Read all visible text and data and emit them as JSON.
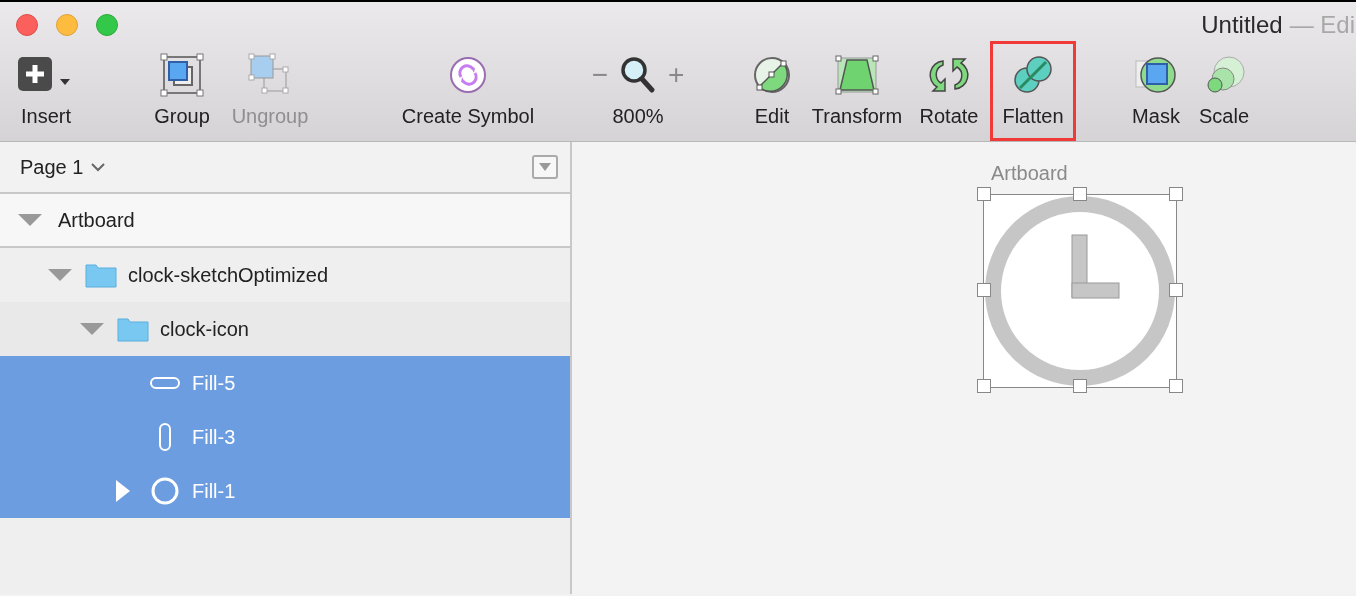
{
  "window": {
    "title": "Untitled",
    "subtitle": "— Edi"
  },
  "toolbar": [
    {
      "kind": "insert",
      "label": "Insert",
      "disabled": false,
      "highlighted": false
    },
    {
      "kind": "group",
      "label": "Group",
      "disabled": false,
      "highlighted": false
    },
    {
      "kind": "ungroup",
      "label": "Ungroup",
      "disabled": true,
      "highlighted": false
    },
    {
      "kind": "symbol",
      "label": "Create Symbol",
      "disabled": false,
      "highlighted": false
    },
    {
      "kind": "zoom",
      "label": "800%",
      "minus": "−",
      "plus": "+",
      "disabled": false,
      "highlighted": false
    },
    {
      "kind": "edit",
      "label": "Edit",
      "disabled": false,
      "highlighted": false
    },
    {
      "kind": "transform",
      "label": "Transform",
      "disabled": false,
      "highlighted": false
    },
    {
      "kind": "rotate",
      "label": "Rotate",
      "disabled": false,
      "highlighted": false
    },
    {
      "kind": "flatten",
      "label": "Flatten",
      "disabled": false,
      "highlighted": true
    },
    {
      "kind": "mask",
      "label": "Mask",
      "disabled": false,
      "highlighted": false
    },
    {
      "kind": "scale",
      "label": "Scale",
      "disabled": false,
      "highlighted": false
    }
  ],
  "page_selector": {
    "label": "Page 1"
  },
  "layers": [
    {
      "kind": "artboard",
      "name": "Artboard",
      "expanded": true,
      "selected": false,
      "children": [
        {
          "kind": "folder",
          "name": "clock-sketchOptimized",
          "expanded": true,
          "selected": false,
          "children": [
            {
              "kind": "folder",
              "name": "clock-icon",
              "expanded": true,
              "selected": false,
              "children": [
                {
                  "kind": "hbar",
                  "name": "Fill-5",
                  "selected": true
                },
                {
                  "kind": "vbar",
                  "name": "Fill-3",
                  "selected": true
                },
                {
                  "kind": "ring",
                  "name": "Fill-1",
                  "expanded": false,
                  "selected": true
                }
              ]
            }
          ]
        }
      ]
    }
  ],
  "canvas": {
    "artboard_label": "Artboard"
  }
}
